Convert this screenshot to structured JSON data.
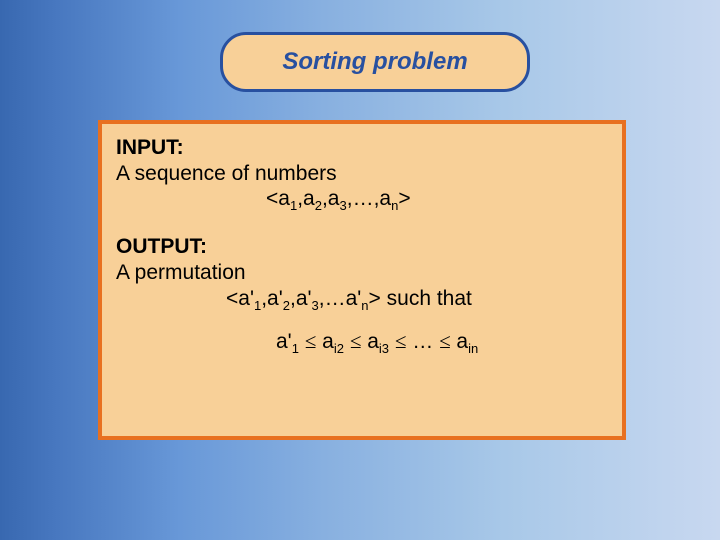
{
  "title": "Sorting problem",
  "input": {
    "label": "INPUT:",
    "desc": "A sequence of numbers",
    "seq_html": "&lt;a<sub>1</sub>,a<sub>2</sub>,a<sub>3</sub>,…,a<sub>n</sub>&gt;"
  },
  "output": {
    "label": "OUTPUT:",
    "desc": "A permutation",
    "seq_html": "&lt;a'<sub>1</sub>,a'<sub>2</sub>,a'<sub>3</sub>,…a'<sub>n</sub>&gt; such that",
    "rel_html": "a'<sub>1</sub> <span class='le'>≤</span> a<sub>i2</sub> <span class='le'>≤</span> a<sub>i3</sub> <span class='le'>≤</span> … <span class='le'>≤</span>  a<sub>in</sub>"
  }
}
